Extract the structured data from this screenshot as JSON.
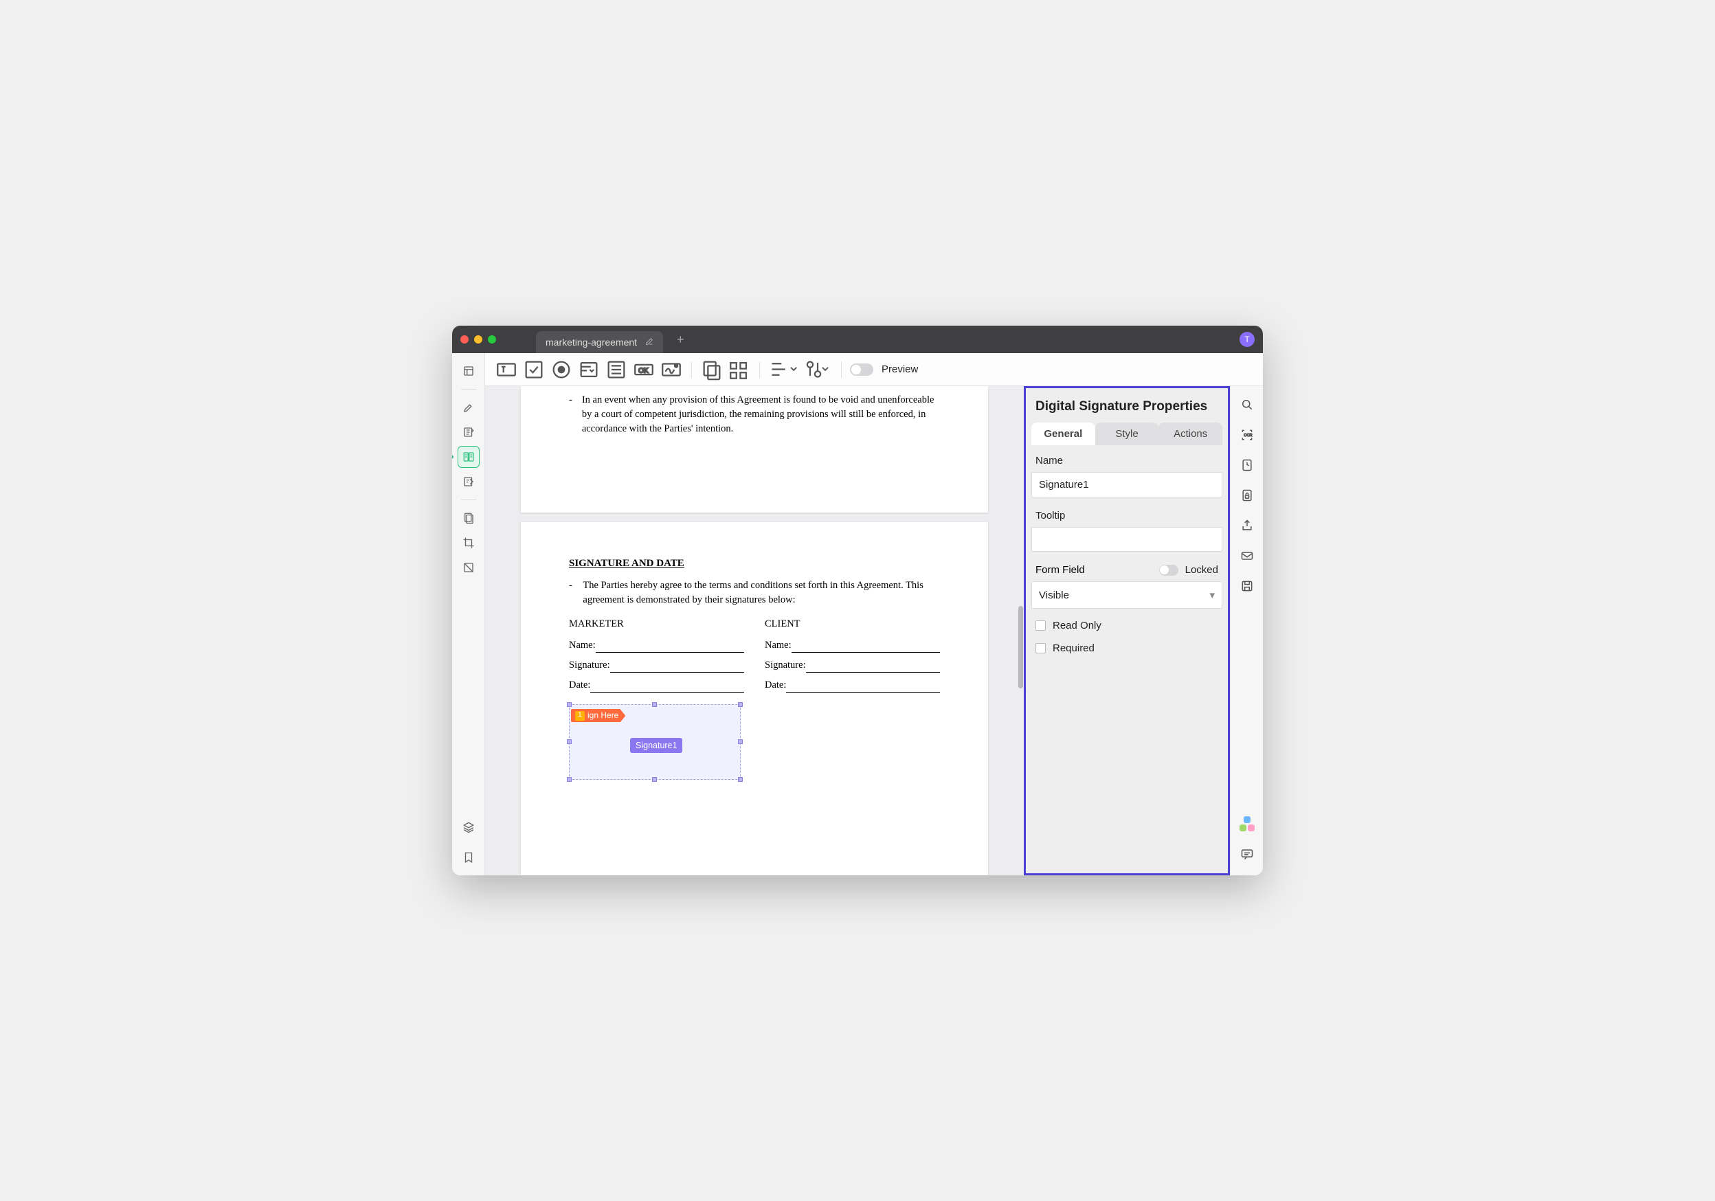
{
  "tab": {
    "title": "marketing-agreement"
  },
  "avatar_letter": "T",
  "toolbar": {
    "preview_label": "Preview"
  },
  "doc": {
    "prev_paragraph": "In an event when any provision of this Agreement is found to be void and unenforceable by a court of competent jurisdiction, the remaining provisions will still be enforced, in accordance with the Parties' intention.",
    "section_title": "SIGNATURE AND DATE",
    "intro": "The Parties hereby agree to the terms and conditions set forth in this Agreement. This agreement is demonstrated by their signatures below:",
    "marketer_heading": "MARKETER",
    "client_heading": "CLIENT",
    "labels": {
      "name": "Name:",
      "signature": "Signature:",
      "date": "Date:"
    }
  },
  "sigfield": {
    "sign_here_badge": "1",
    "sign_here_text": "ign Here",
    "field_label": "Signature1"
  },
  "panel": {
    "title": "Digital Signature Properties",
    "tabs": {
      "general": "General",
      "style": "Style",
      "actions": "Actions"
    },
    "name_label": "Name",
    "name_value": "Signature1",
    "tooltip_label": "Tooltip",
    "tooltip_value": "",
    "formfield_label": "Form Field",
    "locked_label": "Locked",
    "visibility_value": "Visible",
    "readonly_label": "Read Only",
    "required_label": "Required"
  }
}
